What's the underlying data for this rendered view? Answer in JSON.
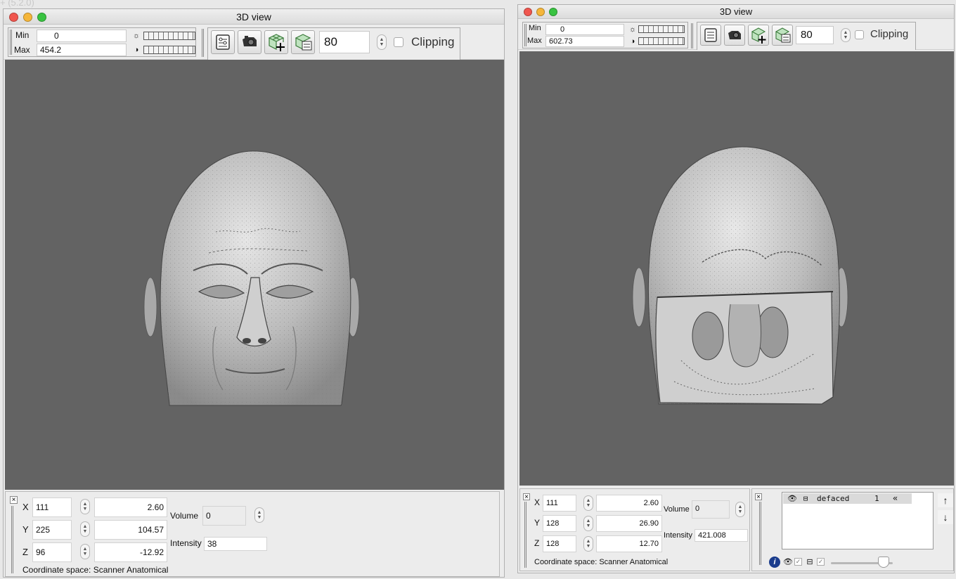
{
  "background_title": "+ (5.2.0)",
  "left_window": {
    "title": "3D view",
    "min_label": "Min",
    "min_value": "0",
    "max_label": "Max",
    "max_value": "454.2",
    "threshold_value": "80",
    "clipping_label": "Clipping",
    "clipping_checked": false,
    "render": {
      "model": "head-surface",
      "background_color": "#636363"
    },
    "coords": {
      "x_label": "X",
      "x_voxel": "111",
      "x_world": "2.60",
      "y_label": "Y",
      "y_voxel": "225",
      "y_world": "104.57",
      "z_label": "Z",
      "z_voxel": "96",
      "z_world": "-12.92",
      "volume_label": "Volume",
      "volume_value": "0",
      "intensity_label": "Intensity",
      "intensity_value": "38",
      "coordinate_space": "Coordinate space: Scanner Anatomical"
    }
  },
  "right_window": {
    "title": "3D view",
    "min_label": "Min",
    "min_value": "0",
    "max_label": "Max",
    "max_value": "602.73",
    "threshold_value": "80",
    "clipping_label": "Clipping",
    "clipping_checked": false,
    "render": {
      "model": "defaced-head-surface",
      "background_color": "#636363"
    },
    "coords": {
      "x_label": "X",
      "x_voxel": "111",
      "x_world": "2.60",
      "y_label": "Y",
      "y_voxel": "128",
      "y_world": "26.90",
      "z_label": "Z",
      "z_voxel": "128",
      "z_world": "12.70",
      "volume_label": "Volume",
      "volume_value": "0",
      "intensity_label": "Intensity",
      "intensity_value": "421.008",
      "coordinate_space": "Coordinate space: Scanner Anatomical"
    },
    "layers": [
      {
        "name": "defaced",
        "volume_index": "1",
        "visible": true,
        "locked": true
      }
    ],
    "layer_opacity": 0.85
  },
  "icons": [
    "brightness-icon",
    "contrast-icon",
    "settings-panel-icon",
    "camera-icon",
    "add-mesh-icon",
    "mesh-options-icon",
    "eye-icon",
    "lock-icon",
    "info-icon",
    "up-arrow-icon",
    "down-arrow-icon",
    "collapse-icon"
  ]
}
